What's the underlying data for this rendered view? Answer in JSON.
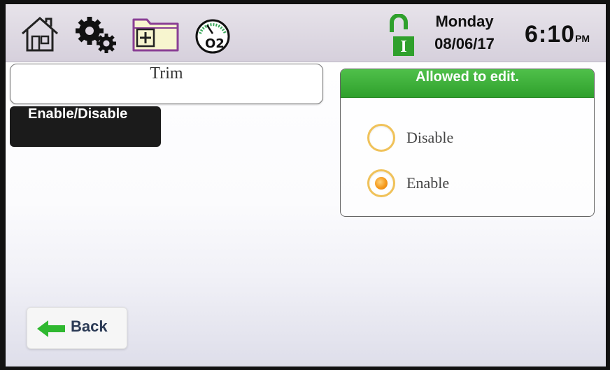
{
  "header": {
    "icons": {
      "home": "home-icon",
      "settings": "gears-icon",
      "folder": "folder-add-icon",
      "gauge": "o2-gauge-icon",
      "lock": "unlocked-padlock-icon"
    },
    "gauge_label": "O2",
    "lock_letter": "I",
    "day": "Monday",
    "date": "08/06/17",
    "time": "6:10",
    "ampm": "PM"
  },
  "trim": {
    "label": "Trim"
  },
  "tab": {
    "label": "Enable/Disable"
  },
  "panel": {
    "header": "Allowed to edit.",
    "options": [
      {
        "label": "Disable",
        "selected": false
      },
      {
        "label": "Enable",
        "selected": true
      }
    ]
  },
  "back": {
    "label": "Back"
  },
  "colors": {
    "accent_green": "#2fa02c",
    "radio_orange": "#f59a1c",
    "radio_ring": "#f0c25a",
    "tab_black": "#1b1b1b"
  }
}
